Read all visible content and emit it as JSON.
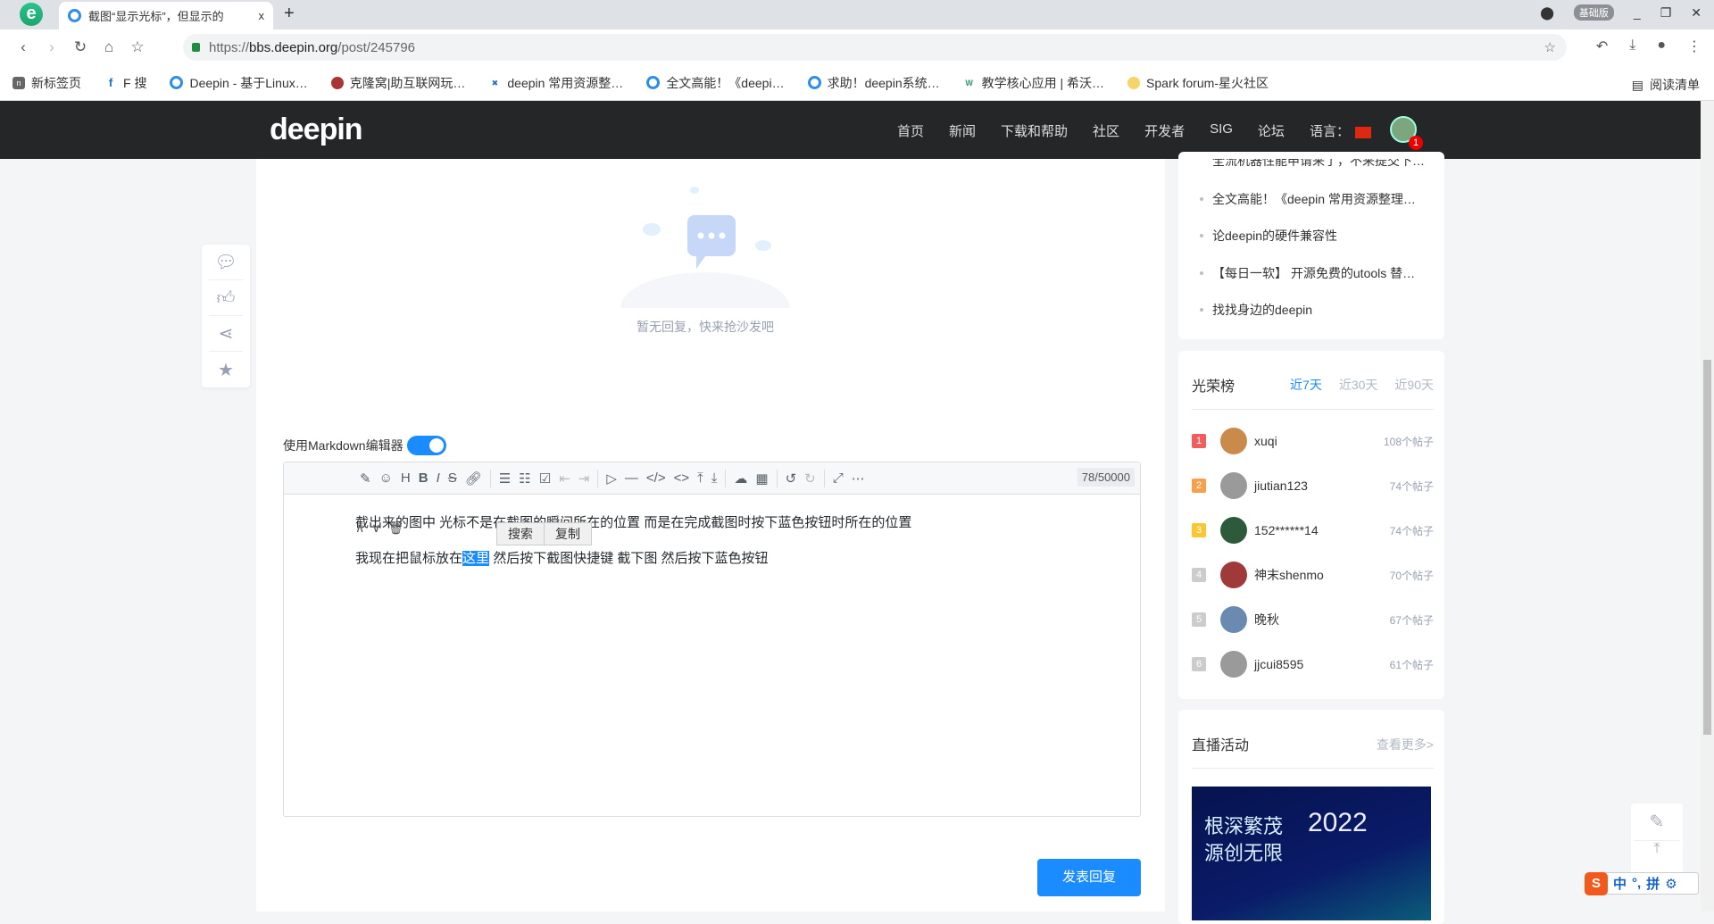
{
  "browser": {
    "tab_title": "截图“显示光标”，但显示的",
    "tab_close": "x",
    "new_tab": "+",
    "vip_label": "基础版",
    "url_prefix": "https://",
    "url_host": "bbs.deepin.org",
    "url_path": "/post/245796",
    "bookmarks": [
      {
        "label": "新标签页",
        "icon": "n"
      },
      {
        "label": "F 搜",
        "icon": "f"
      },
      {
        "label": "Deepin - 基于Linux…",
        "icon": "deepin"
      },
      {
        "label": "克隆窝|助互联网玩…",
        "icon": "bug"
      },
      {
        "label": "deepin 常用资源整…",
        "icon": "x"
      },
      {
        "label": "全文高能！《deepi…",
        "icon": "deepin"
      },
      {
        "label": "求助！deepin系统…",
        "icon": "deepin"
      },
      {
        "label": "教学核心应用 | 希沃…",
        "icon": "w"
      },
      {
        "label": "Spark forum-星火社区",
        "icon": "spark"
      }
    ],
    "reading_list": "阅读清单"
  },
  "site": {
    "logo": "deepin",
    "nav": [
      "首页",
      "新闻",
      "下载和帮助",
      "社区",
      "开发者",
      "SIG",
      "论坛",
      "语言："
    ],
    "notification_count": "1"
  },
  "empty_state": "暂无回复，快来抢沙发吧",
  "editor": {
    "markdown_label": "使用Markdown编辑器",
    "markdown_enabled": true,
    "counter": "78/50000",
    "line1": "截出来的图中 光标不是在截图的瞬间所在的位置 而是在完成截图时按下蓝色按钮时所在的位置",
    "line2_before": "我现在把鼠标放在",
    "line2_selected": "这里",
    "line2_after": " 然后按下截图快捷键 截下图 然后按下蓝色按钮",
    "context_menu": [
      "搜索",
      "复制"
    ],
    "submit": "发表回复"
  },
  "hot_posts": [
    "全流机器性能申请来了，不来提交下…",
    "全文高能！《deepin 常用资源整理…",
    "论deepin的硬件兼容性",
    "【每日一软】 开源免费的utools 替…",
    "找找身边的deepin"
  ],
  "ranking": {
    "title": "光荣榜",
    "tabs": [
      "近7天",
      "近30天",
      "近90天"
    ],
    "active_tab": "近7天",
    "rows": [
      {
        "rank": "1",
        "name": "xuqi",
        "posts": "108个帖子",
        "color": "#f25c5c"
      },
      {
        "rank": "2",
        "name": "jiutian123",
        "posts": "74个帖子",
        "color": "#f7a04a"
      },
      {
        "rank": "3",
        "name": "152******14",
        "posts": "74个帖子",
        "color": "#fcc630"
      },
      {
        "rank": "4",
        "name": "神末shenmo",
        "posts": "70个帖子",
        "color": "#cccccc"
      },
      {
        "rank": "5",
        "name": "晚秋",
        "posts": "67个帖子",
        "color": "#cccccc"
      },
      {
        "rank": "6",
        "name": "jjcui8595",
        "posts": "61个帖子",
        "color": "#cccccc"
      }
    ]
  },
  "live": {
    "title": "直播活动",
    "more": "查看更多>",
    "banner_line1": "根深繁茂",
    "banner_line2": "源创无限",
    "banner_year": "2022"
  },
  "ime": {
    "mode": "中",
    "punct": "°,",
    "input": "拼"
  }
}
